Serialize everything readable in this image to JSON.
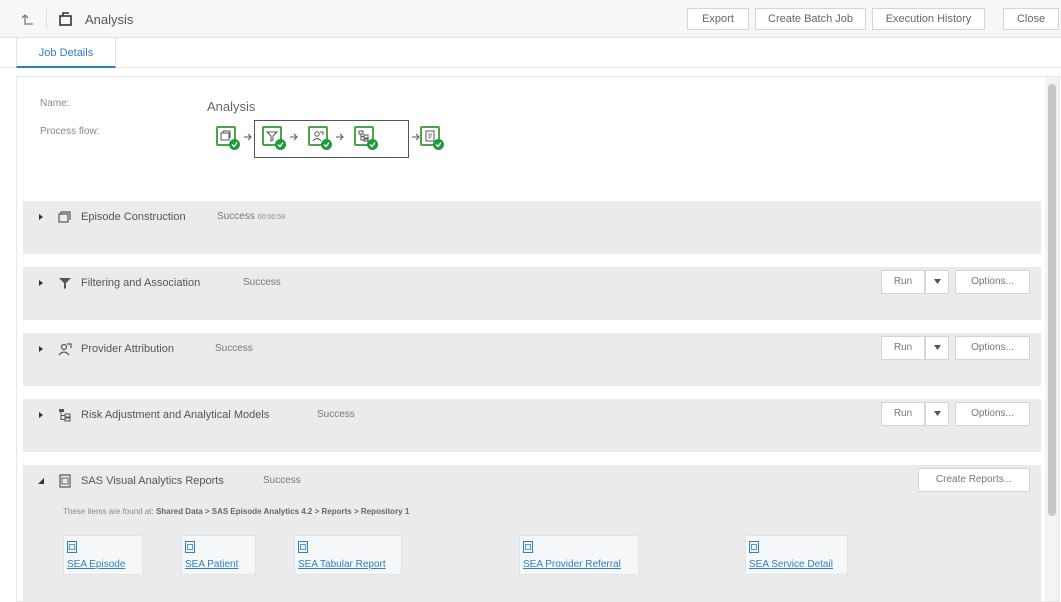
{
  "header": {
    "title": "Analysis",
    "buttons": [
      "Export",
      "Create Batch Job",
      "Execution History",
      "Close"
    ]
  },
  "tabs": [
    {
      "label": "Job Details"
    }
  ],
  "job": {
    "name_label": "Name:",
    "name_value": "Analysis",
    "flow_label": "Process flow:"
  },
  "panels": [
    {
      "title": "Episode Construction",
      "status": "Success",
      "time": "00:00:59",
      "expanded": false,
      "icon": "episode-icon"
    },
    {
      "title": "Filtering and Association",
      "status": "Success",
      "time": "",
      "expanded": false,
      "icon": "filter-icon",
      "run_label": "Run",
      "options_label": "Options..."
    },
    {
      "title": "Provider Attribution",
      "status": "Success",
      "time": "",
      "expanded": false,
      "icon": "provider-icon",
      "run_label": "Run",
      "options_label": "Options..."
    },
    {
      "title": "Risk Adjustment and Analytical Models",
      "status": "Success",
      "time": "",
      "expanded": false,
      "icon": "risk-model-icon",
      "run_label": "Run",
      "options_label": "Options..."
    },
    {
      "title": "SAS Visual Analytics Reports",
      "status": "Success",
      "time": "",
      "expanded": true,
      "icon": "report-icon",
      "create_label": "Create Reports..."
    }
  ],
  "reports_path": {
    "prefix": "These items are found at:",
    "path": "Shared Data > SAS Episode Analytics 4.2 > Reports > Repository 1"
  },
  "reports": [
    "SEA Episode",
    "SEA Patient",
    "SEA Tabular Report",
    "SEA Provider Referral",
    "SEA Service Detail"
  ],
  "colors": {
    "accent": "#2d7fc4",
    "success": "#1e9c3c",
    "panel_bg": "#ebebeb"
  }
}
